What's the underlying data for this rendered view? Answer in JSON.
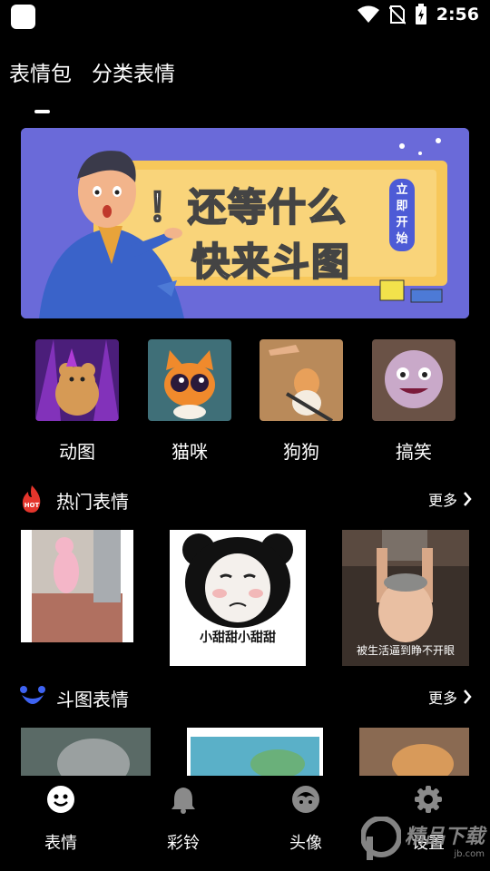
{
  "statusbar": {
    "time": "2:56"
  },
  "tabs": [
    {
      "label": "表情包"
    },
    {
      "label": "分类表情"
    }
  ],
  "banner": {
    "headline_line1": "！还等什么",
    "headline_line2": "快来斗图",
    "badge": "立即开始"
  },
  "categories": [
    {
      "label": "动图"
    },
    {
      "label": "猫咪"
    },
    {
      "label": "狗狗"
    },
    {
      "label": "搞笑"
    }
  ],
  "hot_section": {
    "title": "热门表情",
    "more": "更多",
    "captions": [
      "小甜甜小甜甜",
      "被生活逼到睁不开眼"
    ]
  },
  "battle_section": {
    "title": "斗图表情",
    "more": "更多"
  },
  "bottom_nav": [
    {
      "label": "表情"
    },
    {
      "label": "彩铃"
    },
    {
      "label": "头像"
    },
    {
      "label": "设置"
    }
  ],
  "watermark": {
    "text": "精品下载",
    "sub": "jb.com"
  },
  "colors": {
    "banner_bg": "#6a6ad9",
    "banner_panel": "#f7c75a",
    "hot_icon": "#e4352c",
    "battle_icon": "#3e63f2"
  }
}
